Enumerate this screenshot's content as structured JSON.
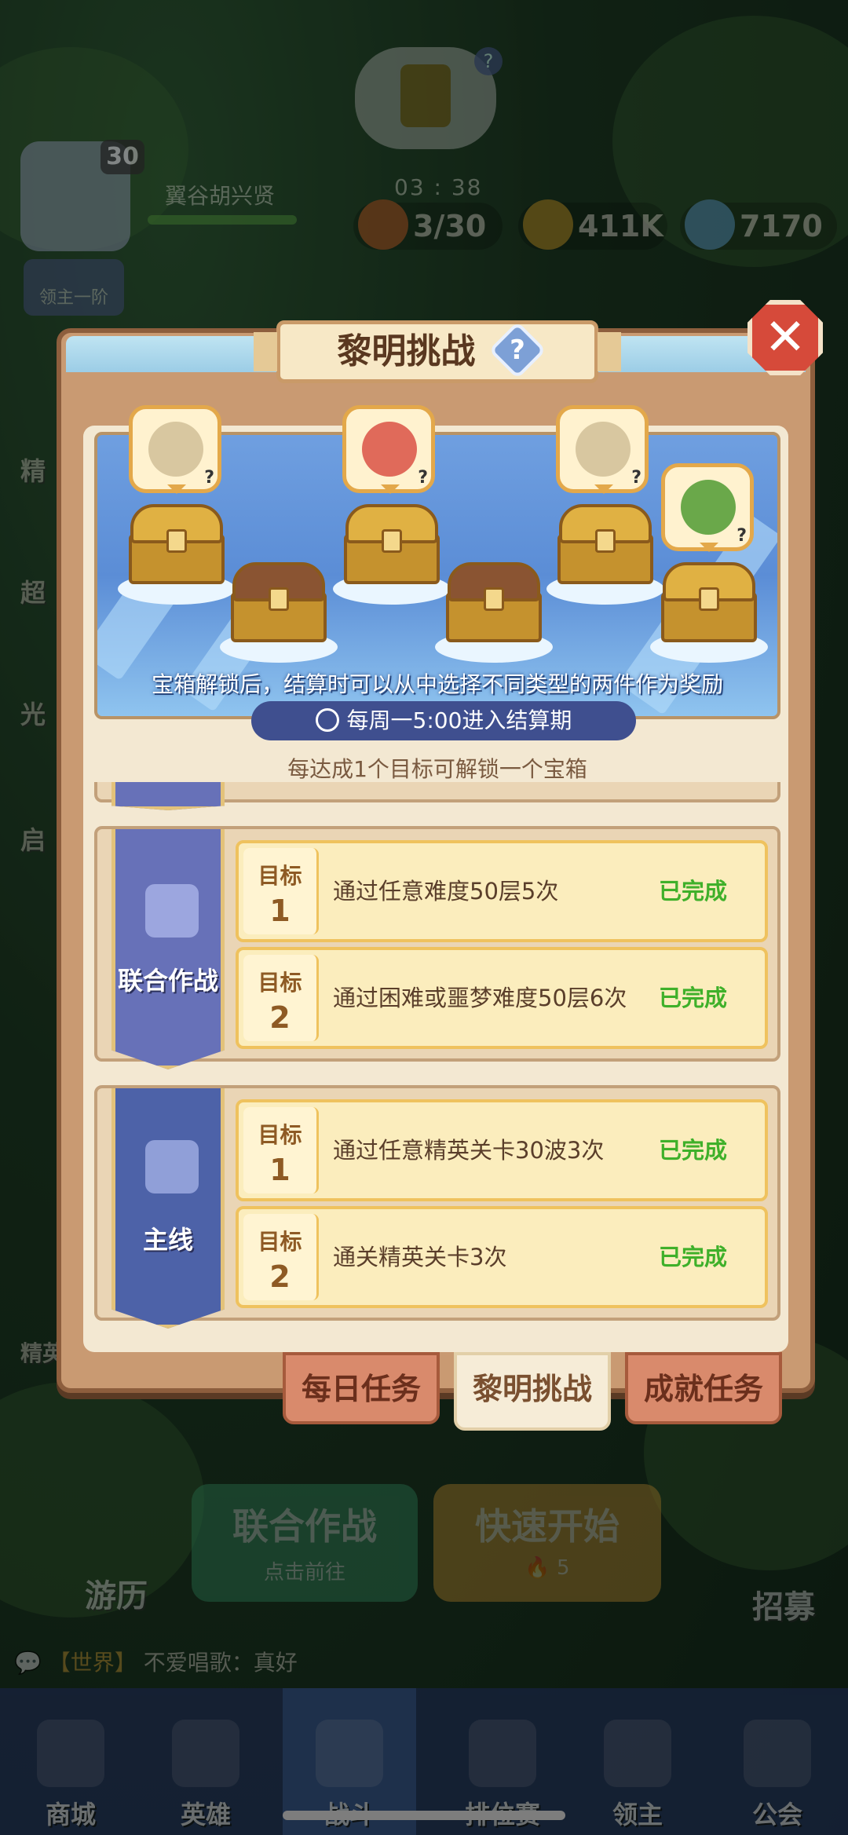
{
  "header": {
    "player_name": "翼谷胡兴贤",
    "player_level": "30",
    "rank_tag": "领主一阶",
    "timer": "03 : 38",
    "energy": "3/30",
    "gold": "411K",
    "gems": "7170"
  },
  "side_labels": [
    "精",
    "超",
    "光",
    "启"
  ],
  "modal": {
    "title": "黎明挑战",
    "help_symbol": "?",
    "close_symbol": "✕",
    "reward_desc": "宝箱解锁后，结算时可以从中选择不同类型的两件作为奖励",
    "settle_period": "每周一5:00进入结算期",
    "unlock_note": "每达成1个目标可解锁一个宝箱",
    "reward_q": "?"
  },
  "groups": [
    {
      "name": "联合作战",
      "goals": [
        {
          "label": "目标",
          "num": "1",
          "text": "通过任意难度50层5次",
          "status": "已完成"
        },
        {
          "label": "目标",
          "num": "2",
          "text": "通过困难或噩梦难度50层6次",
          "status": "已完成"
        }
      ]
    },
    {
      "name": "主线",
      "goals": [
        {
          "label": "目标",
          "num": "1",
          "text": "通过任意精英关卡30波3次",
          "status": "已完成"
        },
        {
          "label": "目标",
          "num": "2",
          "text": "通关精英关卡3次",
          "status": "已完成"
        }
      ]
    }
  ],
  "tabs": [
    "每日任务",
    "黎明挑战",
    "成就任务"
  ],
  "behind": {
    "coop_title": "联合作战",
    "coop_sub": "点击前往",
    "quick_title": "快速开始",
    "quick_cost": "5",
    "explore": "游历",
    "recruit": "招募",
    "elite": "精英"
  },
  "chat": {
    "channel": "【世界】",
    "message": "不爱唱歌：真好"
  },
  "nav": [
    "商城",
    "英雄",
    "战斗",
    "排位赛",
    "领主",
    "公会"
  ],
  "colors": {
    "completed": "#3fb02a",
    "modal_frame": "#c99a72",
    "banner_purple": "#6771b8",
    "banner_blue": "#4d62a8"
  }
}
